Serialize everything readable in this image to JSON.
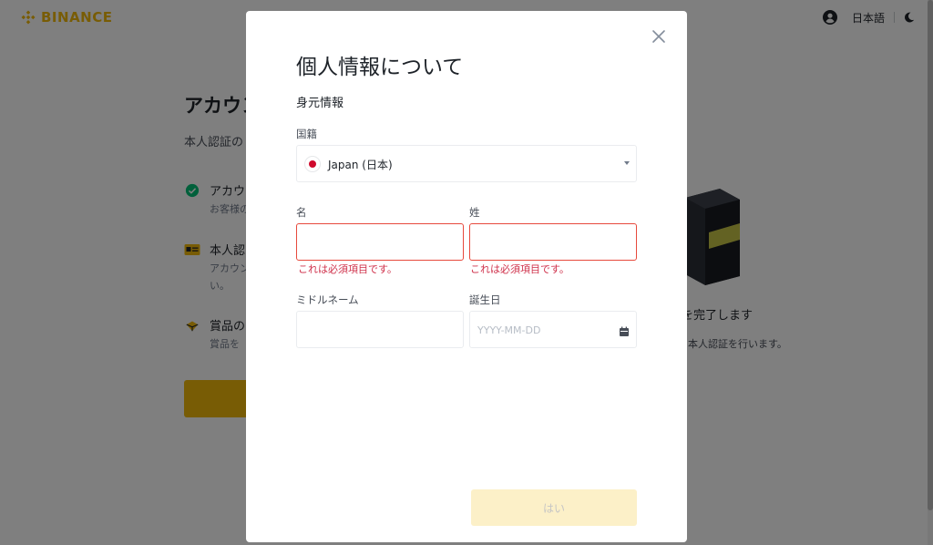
{
  "background": {
    "logo_text": "BINANCE",
    "language": "日本語",
    "page_title": "アカウン",
    "subtitle": "本人認証の",
    "steps": [
      {
        "icon": "check-circle-icon",
        "title": "アカウ",
        "desc": "お客様の"
      },
      {
        "icon": "id-card-icon",
        "title": "本人認",
        "desc": "アカウン\nい。"
      },
      {
        "icon": "gift-icon",
        "title": "賞品の",
        "desc": "賞品を"
      }
    ],
    "right_title": "を完了します",
    "right_desc": "本人認証を行います。"
  },
  "modal": {
    "title": "個人情報について",
    "section_label": "身元情報",
    "nationality": {
      "label": "国籍",
      "value": "Japan (日本)"
    },
    "first_name": {
      "label": "名",
      "value": "",
      "error": "これは必須項目です。"
    },
    "last_name": {
      "label": "姓",
      "value": "",
      "error": "これは必須項目です。"
    },
    "middle_name": {
      "label": "ミドルネーム",
      "value": ""
    },
    "birthdate": {
      "label": "誕生日",
      "value": "",
      "placeholder": "YYYY-MM-DD"
    },
    "submit_label": "はい"
  },
  "colors": {
    "brand": "#f0b90b",
    "error": "#e7493c",
    "submit_disabled_bg": "#fcf0c8",
    "overlay": "rgba(0,0,0,0.5)"
  }
}
